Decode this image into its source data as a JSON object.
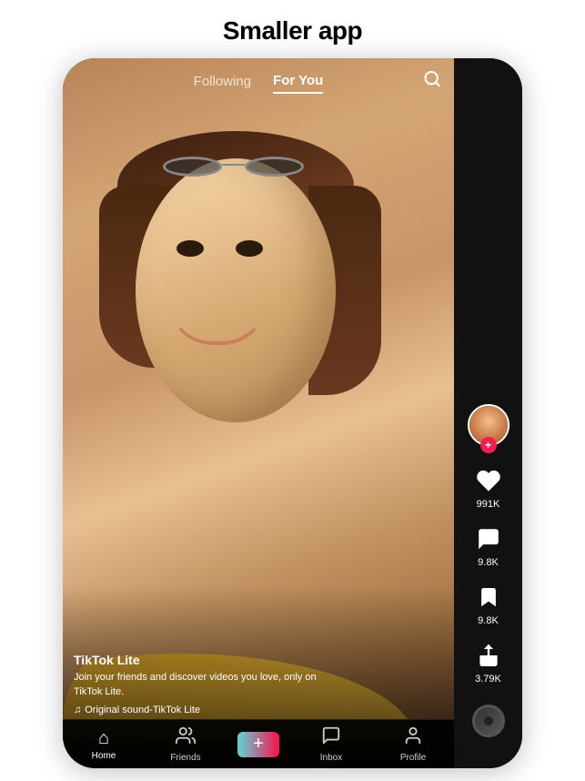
{
  "page": {
    "title": "Smaller app"
  },
  "header": {
    "tab_following": "Following",
    "tab_for_you": "For You"
  },
  "video": {
    "username": "TikTok Lite",
    "description": "Join your friends and discover videos you love, only on TikTok Lite.",
    "sound": "Original sound-TikTok Lite"
  },
  "actions": {
    "likes": "991K",
    "comments": "9.8K",
    "bookmarks": "9.8K",
    "shares": "3.79K"
  },
  "bottom_nav": {
    "home": "Home",
    "friends": "Friends",
    "plus": "+",
    "inbox": "Inbox",
    "profile": "Profile"
  }
}
